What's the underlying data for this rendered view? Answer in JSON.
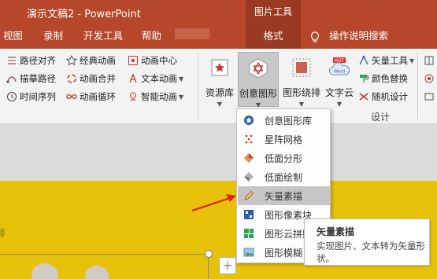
{
  "window": {
    "title": "演示文稿2 - PowerPoint",
    "context_tab_header": "图片工具"
  },
  "tabs": [
    {
      "label": "视图"
    },
    {
      "label": "录制"
    },
    {
      "label": "开发工具"
    },
    {
      "label": "帮助"
    },
    {
      "label": "格式",
      "active": true
    },
    {
      "label": "操作说明搜索"
    }
  ],
  "ribbon": {
    "col1": [
      "路径对齐",
      "描摹路径",
      "时间序列"
    ],
    "col2": [
      "经典动画",
      "动画合并",
      "动画循环"
    ],
    "col3": [
      "动画中心",
      "文本动画",
      "智能动画"
    ],
    "big_buttons": [
      "资源库",
      "创意图形",
      "图形绕排",
      "文字云"
    ],
    "design": [
      "矢量工具",
      "颜色替换",
      "随机设计"
    ],
    "design_group_label": "设计",
    "wordcloud_badge": "HOT",
    "wordcloud_text": "Word"
  },
  "dropdown": {
    "items": [
      {
        "label": "创意图形库",
        "icon": "star-badge-icon"
      },
      {
        "label": "星阵网格",
        "icon": "dot-grid-icon"
      },
      {
        "label": "低面分形",
        "icon": "lowpoly-icon"
      },
      {
        "label": "低面绘制",
        "icon": "lowpoly-draw-icon"
      },
      {
        "label": "矢量素描",
        "icon": "pencil-icon",
        "highlighted": true
      },
      {
        "label": "图形像素块",
        "icon": "pixel-icon"
      },
      {
        "label": "图形云拼贴",
        "icon": "collage-icon"
      },
      {
        "label": "图形模糊",
        "icon": "blur-image-icon"
      }
    ]
  },
  "tooltip": {
    "title": "矢量素描",
    "description": "实现图片、文本转为矢量形状。"
  },
  "colors": {
    "accent": "#b7472a",
    "context_tab": "#9a3a22",
    "slide": "#e8c20a",
    "annotation_arrow": "#e02020"
  }
}
